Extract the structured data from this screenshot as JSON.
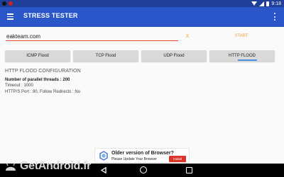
{
  "status_bar": {
    "time": "9:18"
  },
  "app_bar": {
    "title": "STRESS TESTER"
  },
  "target": {
    "url_value": "eakteam.com",
    "clear_label": "X",
    "start_label": "START"
  },
  "tabs": [
    {
      "label": "ICMP Flood"
    },
    {
      "label": "TCP Flood"
    },
    {
      "label": "UDP Flood"
    },
    {
      "label": "HTTP FLOOD",
      "selected": true
    }
  ],
  "config": {
    "title": "HTTP FLOOD CONFIGURATION",
    "threads_line": "Number of parallel threads : 200",
    "timeout_line": "Timeout : 1000",
    "port_redirect_line": "HTTP/S Port : 80,  Follow Redirects : No"
  },
  "ad": {
    "title": "Older version of Browser?",
    "subtitle": "Please Update Your Browser",
    "button": "Install"
  },
  "watermark": {
    "text": "GetAndroid.fr"
  },
  "colors": {
    "status_bar": "#1f3f99",
    "app_bar": "#2a56c9",
    "accent_orange": "#f4a339",
    "input_underline": "#e3462c",
    "tab_indicator": "#4a90e2",
    "ad_button": "#d9352b"
  },
  "icons": [
    "menu-icon",
    "overflow-menu-icon",
    "wifi-icon",
    "signal-icon",
    "battery-icon",
    "back-icon",
    "home-icon",
    "recents-icon",
    "browser-icon",
    "android-icon"
  ]
}
